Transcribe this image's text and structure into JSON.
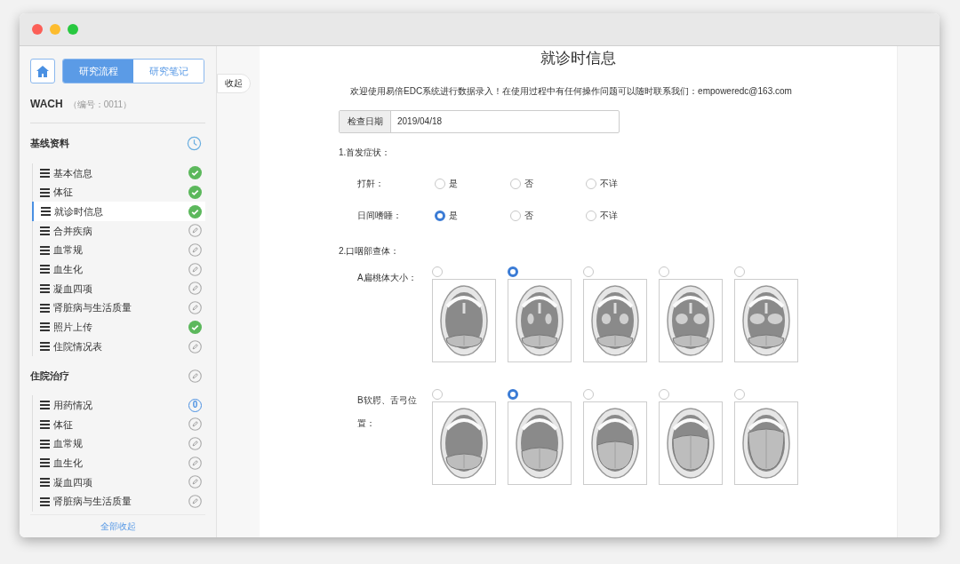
{
  "sidebar": {
    "tabs": [
      {
        "label": "研究流程",
        "selected": true
      },
      {
        "label": "研究笔记",
        "selected": false
      }
    ],
    "patient": {
      "name": "WACH",
      "id": "（编号：0011）"
    },
    "sections": [
      {
        "title": "基线资料",
        "kind": "clock",
        "items": [
          {
            "label": "基本信息",
            "kind": "done",
            "selected": false
          },
          {
            "label": "体征",
            "kind": "done",
            "selected": false
          },
          {
            "label": "就诊时信息",
            "kind": "done",
            "selected": true
          },
          {
            "label": "合并疾病",
            "kind": "edit",
            "selected": false
          },
          {
            "label": "血常规",
            "kind": "edit",
            "selected": false
          },
          {
            "label": "血生化",
            "kind": "edit",
            "selected": false
          },
          {
            "label": "凝血四项",
            "kind": "edit",
            "selected": false
          },
          {
            "label": "肾脏病与生活质量",
            "kind": "edit",
            "selected": false
          },
          {
            "label": "照片上传",
            "kind": "done",
            "selected": false
          },
          {
            "label": "住院情况表",
            "kind": "edit",
            "selected": false
          }
        ]
      },
      {
        "title": "住院治疗",
        "kind": "edit",
        "items": [
          {
            "label": "用药情况",
            "kind": "count",
            "count": "0",
            "selected": false
          },
          {
            "label": "体征",
            "kind": "edit",
            "selected": false
          },
          {
            "label": "血常规",
            "kind": "edit",
            "selected": false
          },
          {
            "label": "血生化",
            "kind": "edit",
            "selected": false
          },
          {
            "label": "凝血四项",
            "kind": "edit",
            "selected": false
          },
          {
            "label": "肾脏病与生活质量",
            "kind": "edit",
            "selected": false
          }
        ]
      }
    ],
    "collapse_all": "全部收起"
  },
  "collapse_tab": "收起",
  "form": {
    "title": "就诊时信息",
    "notice": "欢迎使用易倍EDC系统进行数据录入！在使用过程中有任何操作问题可以随时联系我们：empoweredc@163.com",
    "date": {
      "label": "检查日期",
      "value": "2019/04/18"
    },
    "questions": [
      {
        "kind": "radio",
        "title": "1.首发症状：",
        "rows": [
          {
            "label": "打鼾：",
            "options": [
              {
                "label": "是",
                "selected": false
              },
              {
                "label": "否",
                "selected": false
              },
              {
                "label": "不详",
                "selected": false
              }
            ]
          },
          {
            "label": "日间嗜睡：",
            "options": [
              {
                "label": "是",
                "selected": true
              },
              {
                "label": "否",
                "selected": false
              },
              {
                "label": "不详",
                "selected": false
              }
            ]
          }
        ]
      },
      {
        "kind": "image",
        "title": "2.口咽部查体：",
        "rows": [
          {
            "label": "A扁桃体大小：",
            "options": [
              {
                "selected": false
              },
              {
                "selected": true
              },
              {
                "selected": false
              },
              {
                "selected": false
              },
              {
                "selected": false
              }
            ]
          },
          {
            "label": "B软腭、舌弓位置：",
            "options": [
              {
                "selected": false
              },
              {
                "selected": true
              },
              {
                "selected": false
              },
              {
                "selected": false
              },
              {
                "selected": false
              }
            ]
          }
        ]
      }
    ]
  }
}
